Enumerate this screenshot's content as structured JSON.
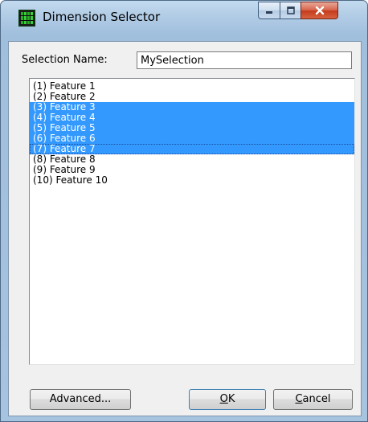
{
  "window": {
    "title": "Dimension Selector",
    "caption_buttons": {
      "minimize": "minimize-icon",
      "maximize": "maximize-icon",
      "close": "close-icon"
    }
  },
  "form": {
    "selection_name_label": "Selection Name:",
    "selection_name_value": "MySelection"
  },
  "list": {
    "items": [
      {
        "label": "(1) Feature  1",
        "selected": false
      },
      {
        "label": "(2) Feature  2",
        "selected": false
      },
      {
        "label": "(3) Feature  3",
        "selected": true
      },
      {
        "label": "(4) Feature  4",
        "selected": true
      },
      {
        "label": "(5) Feature  5",
        "selected": true
      },
      {
        "label": "(6) Feature  6",
        "selected": true
      },
      {
        "label": "(7) Feature  7",
        "selected": true,
        "focused": true
      },
      {
        "label": "(8) Feature  8",
        "selected": false
      },
      {
        "label": "(9) Feature  9",
        "selected": false
      },
      {
        "label": "(10) Feature  10",
        "selected": false
      }
    ]
  },
  "buttons": {
    "advanced": "Advanced...",
    "ok_mnemonic": "O",
    "ok_rest": "K",
    "cancel_mnemonic": "C",
    "cancel_rest": "ancel"
  },
  "colors": {
    "selection": "#3399ff",
    "title_glass": "#b5cfe7",
    "close_button": "#c43c1c"
  }
}
